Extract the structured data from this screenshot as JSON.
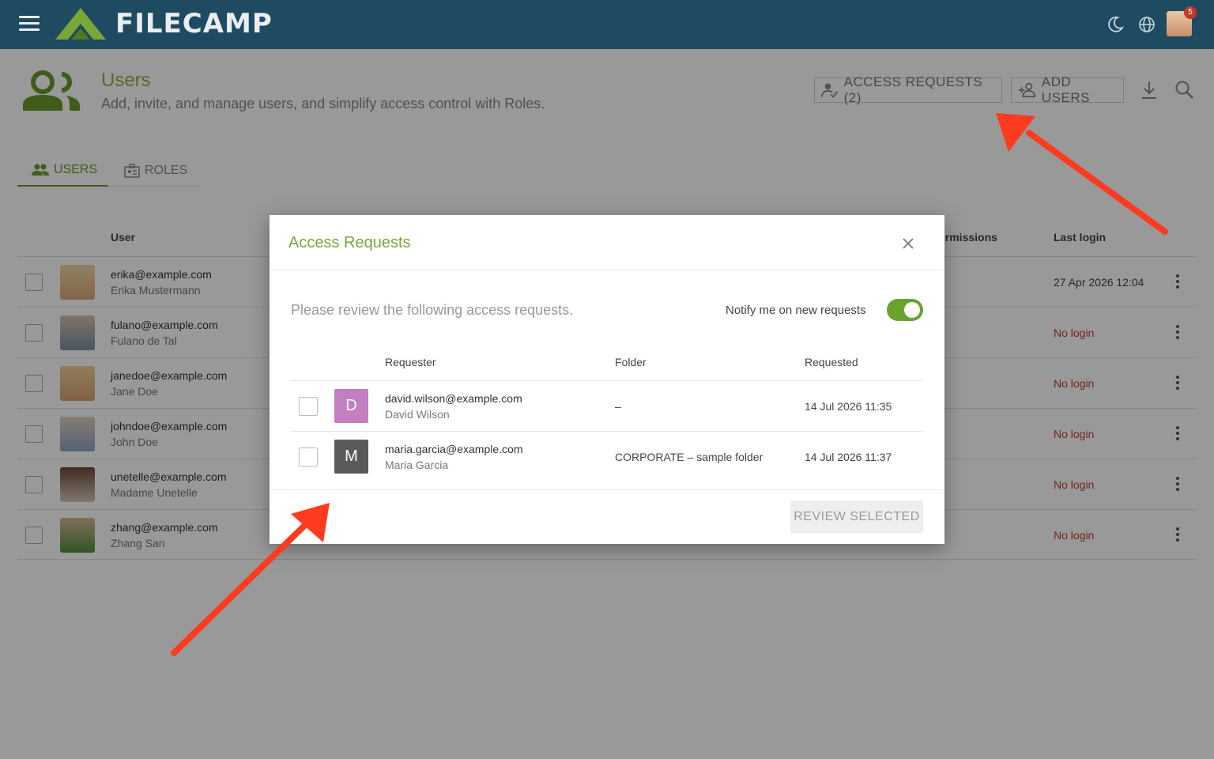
{
  "app": {
    "logo_text": "FILECAMP",
    "notification_count": "5"
  },
  "header": {
    "title": "Users",
    "subtitle": "Add, invite, and manage users, and simplify access control with Roles.",
    "access_requests_label": "ACCESS REQUESTS (2)",
    "add_users_label": "ADD USERS"
  },
  "tabs": [
    {
      "label": "USERS",
      "active": true
    },
    {
      "label": "ROLES",
      "active": false
    }
  ],
  "table": {
    "columns": {
      "user": "User",
      "permissions": "ermissions",
      "last_login": "Last login"
    },
    "rows": [
      {
        "email": "erika@example.com",
        "name": "Erika Mustermann",
        "last_login": "27 Apr 2026 12:04"
      },
      {
        "email": "fulano@example.com",
        "name": "Fulano de Tal",
        "last_login": "No login"
      },
      {
        "email": "janedoe@example.com",
        "name": "Jane Doe",
        "last_login": "No login"
      },
      {
        "email": "johndoe@example.com",
        "name": "John Doe",
        "last_login": "No login"
      },
      {
        "email": "unetelle@example.com",
        "name": "Madame Unetelle",
        "last_login": "No login"
      },
      {
        "email": "zhang@example.com",
        "name": "Zhang San",
        "last_login": "No login"
      }
    ]
  },
  "modal": {
    "title": "Access Requests",
    "intro": "Please review the following access requests.",
    "notify_label": "Notify me on new requests",
    "notify_enabled": true,
    "columns": {
      "requester": "Requester",
      "folder": "Folder",
      "requested": "Requested"
    },
    "requests": [
      {
        "initial": "D",
        "avatar_color": "#c27fc2",
        "email": "david.wilson@example.com",
        "name": "David Wilson",
        "folder": "–",
        "requested": "14 Jul 2026 11:35"
      },
      {
        "initial": "M",
        "avatar_color": "#5a5a5a",
        "email": "maria.garcia@example.com",
        "name": "Maria Garcia",
        "folder": "CORPORATE – sample folder",
        "requested": "14 Jul 2026 11:37"
      }
    ],
    "review_button": "REVIEW SELECTED"
  },
  "colors": {
    "topbar": "#1e4a62",
    "accent_green": "#7aa63a",
    "no_login_red": "#c0392b",
    "arrow_red": "#ff3b1f"
  }
}
